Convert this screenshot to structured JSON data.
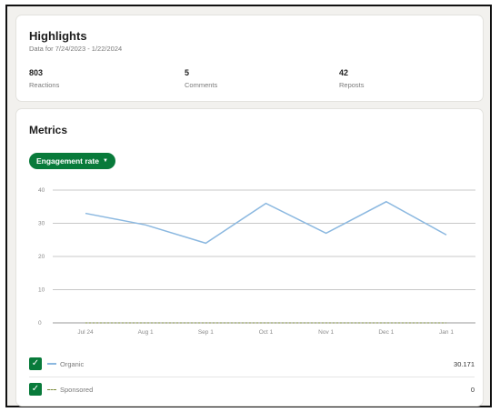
{
  "highlights": {
    "title": "Highlights",
    "subtitle": "Data for 7/24/2023 - 1/22/2024",
    "stats": [
      {
        "value": "803",
        "label": "Reactions"
      },
      {
        "value": "5",
        "label": "Comments"
      },
      {
        "value": "42",
        "label": "Reposts"
      }
    ]
  },
  "metrics": {
    "title": "Metrics",
    "dropdown_label": "Engagement rate",
    "legend": [
      {
        "label": "Organic",
        "value": "30.171",
        "checked": true,
        "color": "#8bb8e0"
      },
      {
        "label": "Sponsored",
        "value": "0",
        "checked": true,
        "color": "#7a8a3a"
      }
    ]
  },
  "chart_data": {
    "type": "line",
    "x": [
      "Jul 24",
      "Aug 1",
      "Sep 1",
      "Oct 1",
      "Nov 1",
      "Dec 1",
      "Jan 1"
    ],
    "yticks": [
      "40",
      "30",
      "20",
      "10",
      "0"
    ],
    "ylim": [
      0,
      40
    ],
    "grid": true,
    "series": [
      {
        "name": "Organic",
        "values": [
          33,
          29.5,
          24,
          36,
          27,
          36.5,
          26.5
        ],
        "color": "#8bb8e0"
      },
      {
        "name": "Sponsored",
        "values": [
          0,
          0,
          0,
          0,
          0,
          0,
          0
        ],
        "color": "#7a8a3a"
      }
    ]
  },
  "colors": {
    "accent": "#087a3a"
  }
}
